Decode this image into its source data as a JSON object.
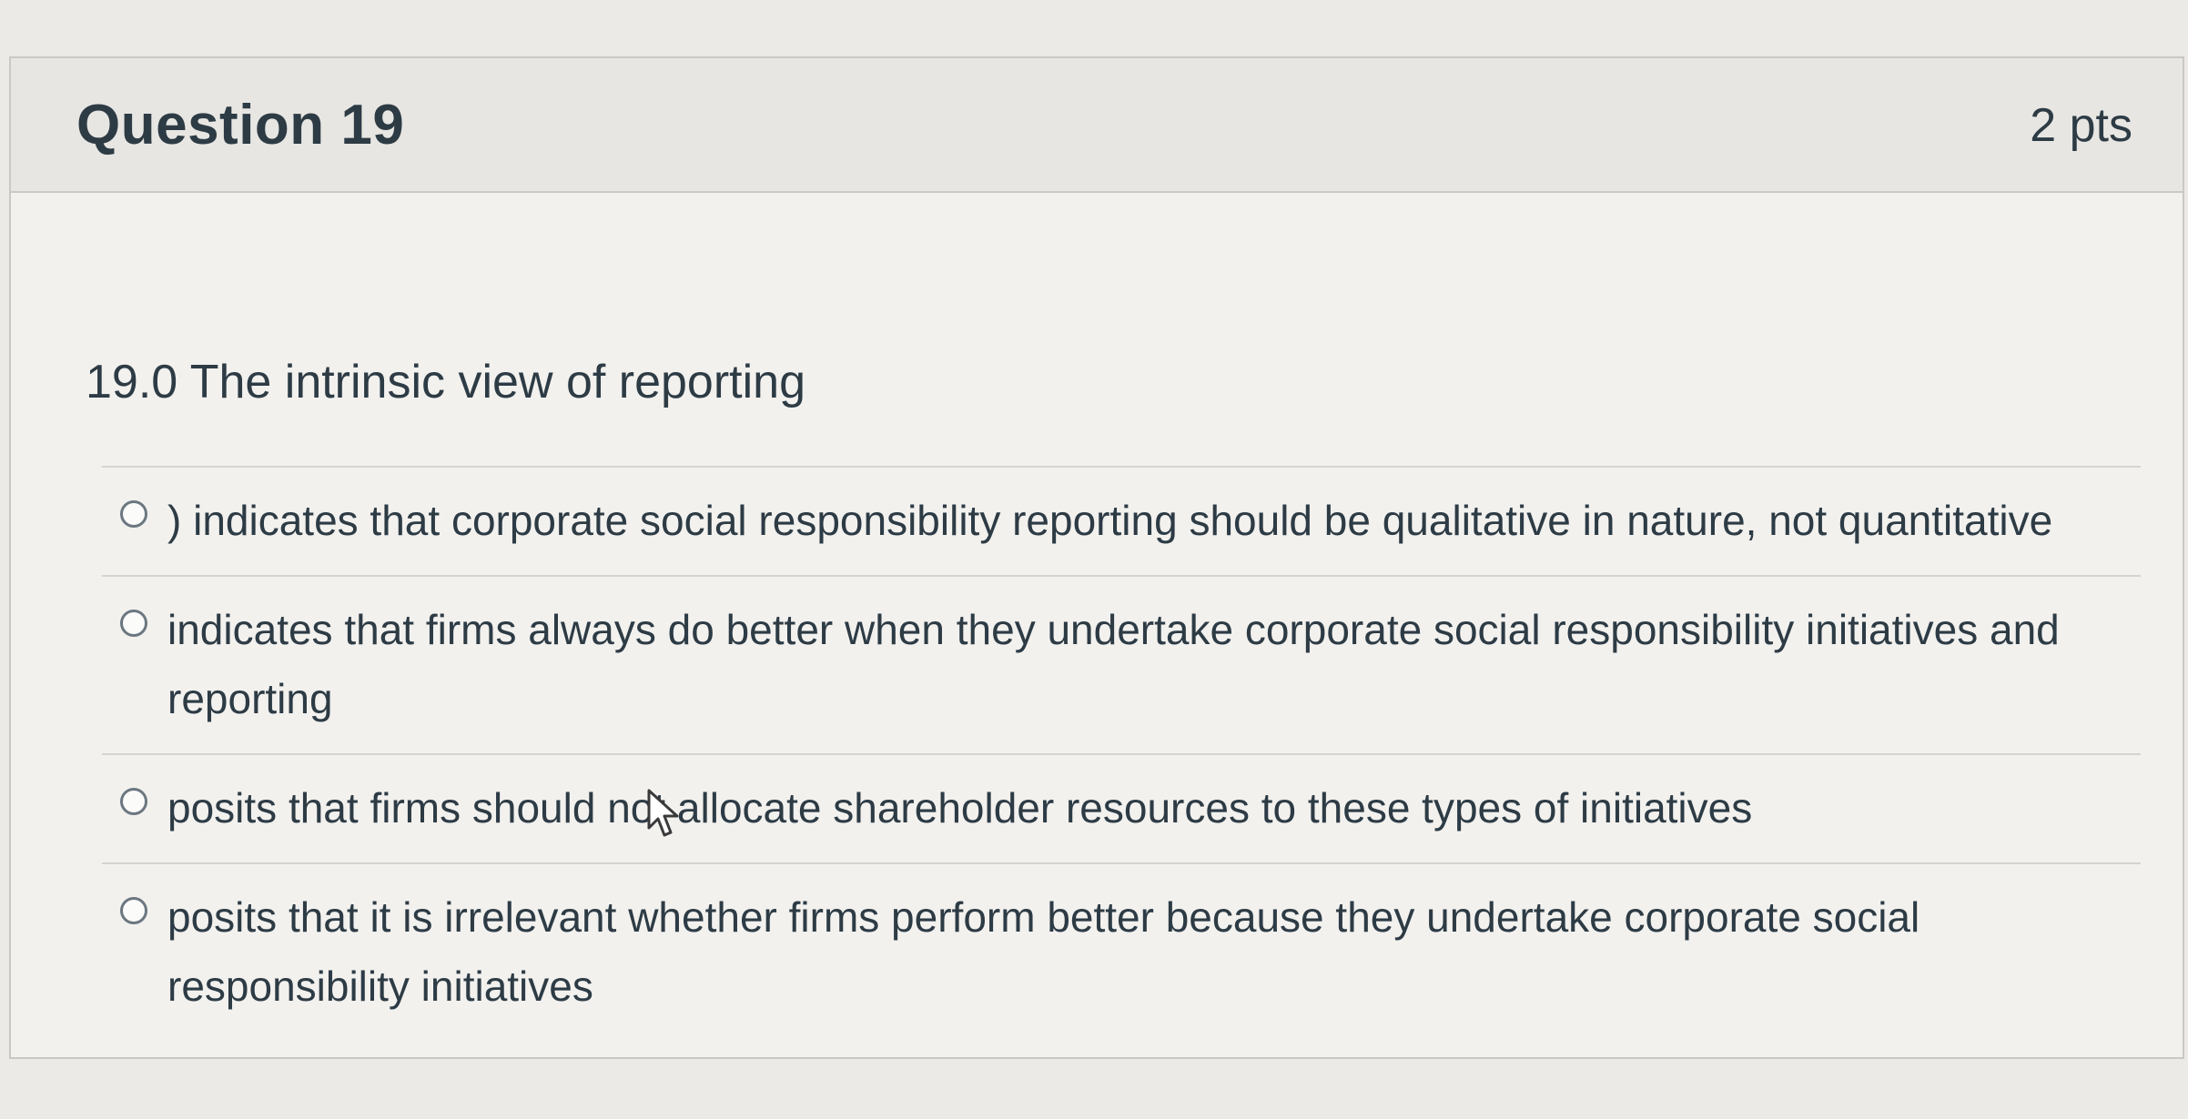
{
  "question": {
    "title": "Question 19",
    "points": "2 pts",
    "text": "19.0 The intrinsic view of  reporting"
  },
  "answers": [
    {
      "label": ") indicates that corporate social responsibility reporting should be qualitative in nature, not quantitative"
    },
    {
      "label": "indicates that firms always do better when they undertake corporate social responsibility initiatives and reporting"
    },
    {
      "label": "posits that firms should not allocate shareholder resources to these types of initiatives"
    },
    {
      "label": "posits that it is irrelevant whether firms perform better because they undertake corporate social responsibility initiatives"
    }
  ],
  "icons": {
    "radio": "radio-button-icon",
    "cursor": "mouse-pointer-icon"
  }
}
